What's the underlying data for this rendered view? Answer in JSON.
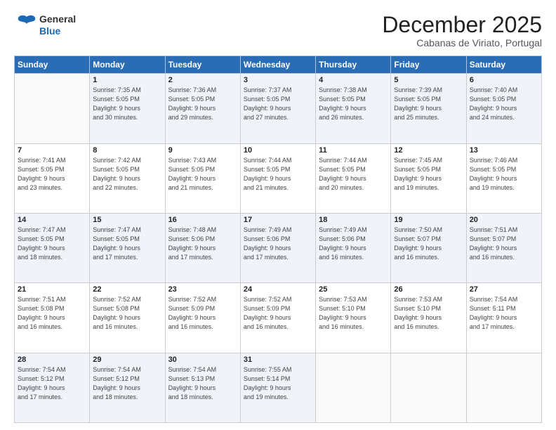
{
  "header": {
    "logo_line1": "General",
    "logo_line2": "Blue",
    "month": "December 2025",
    "location": "Cabanas de Viriato, Portugal"
  },
  "weekdays": [
    "Sunday",
    "Monday",
    "Tuesday",
    "Wednesday",
    "Thursday",
    "Friday",
    "Saturday"
  ],
  "weeks": [
    [
      {
        "day": "",
        "info": ""
      },
      {
        "day": "1",
        "info": "Sunrise: 7:35 AM\nSunset: 5:05 PM\nDaylight: 9 hours\nand 30 minutes."
      },
      {
        "day": "2",
        "info": "Sunrise: 7:36 AM\nSunset: 5:05 PM\nDaylight: 9 hours\nand 29 minutes."
      },
      {
        "day": "3",
        "info": "Sunrise: 7:37 AM\nSunset: 5:05 PM\nDaylight: 9 hours\nand 27 minutes."
      },
      {
        "day": "4",
        "info": "Sunrise: 7:38 AM\nSunset: 5:05 PM\nDaylight: 9 hours\nand 26 minutes."
      },
      {
        "day": "5",
        "info": "Sunrise: 7:39 AM\nSunset: 5:05 PM\nDaylight: 9 hours\nand 25 minutes."
      },
      {
        "day": "6",
        "info": "Sunrise: 7:40 AM\nSunset: 5:05 PM\nDaylight: 9 hours\nand 24 minutes."
      }
    ],
    [
      {
        "day": "7",
        "info": "Sunrise: 7:41 AM\nSunset: 5:05 PM\nDaylight: 9 hours\nand 23 minutes."
      },
      {
        "day": "8",
        "info": "Sunrise: 7:42 AM\nSunset: 5:05 PM\nDaylight: 9 hours\nand 22 minutes."
      },
      {
        "day": "9",
        "info": "Sunrise: 7:43 AM\nSunset: 5:05 PM\nDaylight: 9 hours\nand 21 minutes."
      },
      {
        "day": "10",
        "info": "Sunrise: 7:44 AM\nSunset: 5:05 PM\nDaylight: 9 hours\nand 21 minutes."
      },
      {
        "day": "11",
        "info": "Sunrise: 7:44 AM\nSunset: 5:05 PM\nDaylight: 9 hours\nand 20 minutes."
      },
      {
        "day": "12",
        "info": "Sunrise: 7:45 AM\nSunset: 5:05 PM\nDaylight: 9 hours\nand 19 minutes."
      },
      {
        "day": "13",
        "info": "Sunrise: 7:46 AM\nSunset: 5:05 PM\nDaylight: 9 hours\nand 19 minutes."
      }
    ],
    [
      {
        "day": "14",
        "info": "Sunrise: 7:47 AM\nSunset: 5:05 PM\nDaylight: 9 hours\nand 18 minutes."
      },
      {
        "day": "15",
        "info": "Sunrise: 7:47 AM\nSunset: 5:05 PM\nDaylight: 9 hours\nand 17 minutes."
      },
      {
        "day": "16",
        "info": "Sunrise: 7:48 AM\nSunset: 5:06 PM\nDaylight: 9 hours\nand 17 minutes."
      },
      {
        "day": "17",
        "info": "Sunrise: 7:49 AM\nSunset: 5:06 PM\nDaylight: 9 hours\nand 17 minutes."
      },
      {
        "day": "18",
        "info": "Sunrise: 7:49 AM\nSunset: 5:06 PM\nDaylight: 9 hours\nand 16 minutes."
      },
      {
        "day": "19",
        "info": "Sunrise: 7:50 AM\nSunset: 5:07 PM\nDaylight: 9 hours\nand 16 minutes."
      },
      {
        "day": "20",
        "info": "Sunrise: 7:51 AM\nSunset: 5:07 PM\nDaylight: 9 hours\nand 16 minutes."
      }
    ],
    [
      {
        "day": "21",
        "info": "Sunrise: 7:51 AM\nSunset: 5:08 PM\nDaylight: 9 hours\nand 16 minutes."
      },
      {
        "day": "22",
        "info": "Sunrise: 7:52 AM\nSunset: 5:08 PM\nDaylight: 9 hours\nand 16 minutes."
      },
      {
        "day": "23",
        "info": "Sunrise: 7:52 AM\nSunset: 5:09 PM\nDaylight: 9 hours\nand 16 minutes."
      },
      {
        "day": "24",
        "info": "Sunrise: 7:52 AM\nSunset: 5:09 PM\nDaylight: 9 hours\nand 16 minutes."
      },
      {
        "day": "25",
        "info": "Sunrise: 7:53 AM\nSunset: 5:10 PM\nDaylight: 9 hours\nand 16 minutes."
      },
      {
        "day": "26",
        "info": "Sunrise: 7:53 AM\nSunset: 5:10 PM\nDaylight: 9 hours\nand 16 minutes."
      },
      {
        "day": "27",
        "info": "Sunrise: 7:54 AM\nSunset: 5:11 PM\nDaylight: 9 hours\nand 17 minutes."
      }
    ],
    [
      {
        "day": "28",
        "info": "Sunrise: 7:54 AM\nSunset: 5:12 PM\nDaylight: 9 hours\nand 17 minutes."
      },
      {
        "day": "29",
        "info": "Sunrise: 7:54 AM\nSunset: 5:12 PM\nDaylight: 9 hours\nand 18 minutes."
      },
      {
        "day": "30",
        "info": "Sunrise: 7:54 AM\nSunset: 5:13 PM\nDaylight: 9 hours\nand 18 minutes."
      },
      {
        "day": "31",
        "info": "Sunrise: 7:55 AM\nSunset: 5:14 PM\nDaylight: 9 hours\nand 19 minutes."
      },
      {
        "day": "",
        "info": ""
      },
      {
        "day": "",
        "info": ""
      },
      {
        "day": "",
        "info": ""
      }
    ]
  ]
}
